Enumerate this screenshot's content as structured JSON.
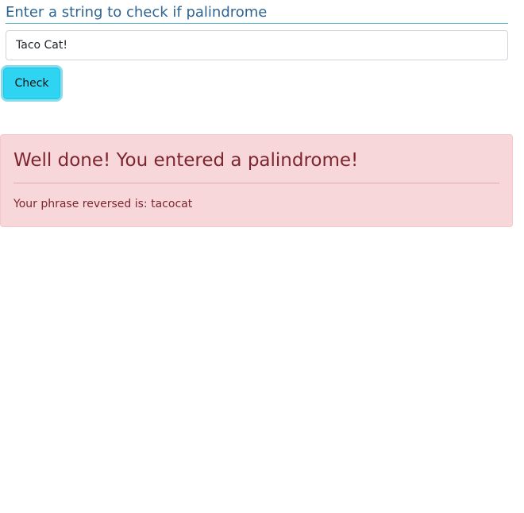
{
  "form": {
    "prompt": "Enter a string to check if palindrome",
    "input_value": "Taco Cat!",
    "check_label": "Check"
  },
  "result": {
    "heading": "Well done! You entered a palindrome!",
    "reversed_prefix": "Your phrase reversed is: ",
    "reversed_value": "tacocat"
  },
  "colors": {
    "accent": "#2fd4f2",
    "heading_text": "#2e6592",
    "alert_background": "#f8d7da",
    "alert_text": "#7c2630"
  }
}
